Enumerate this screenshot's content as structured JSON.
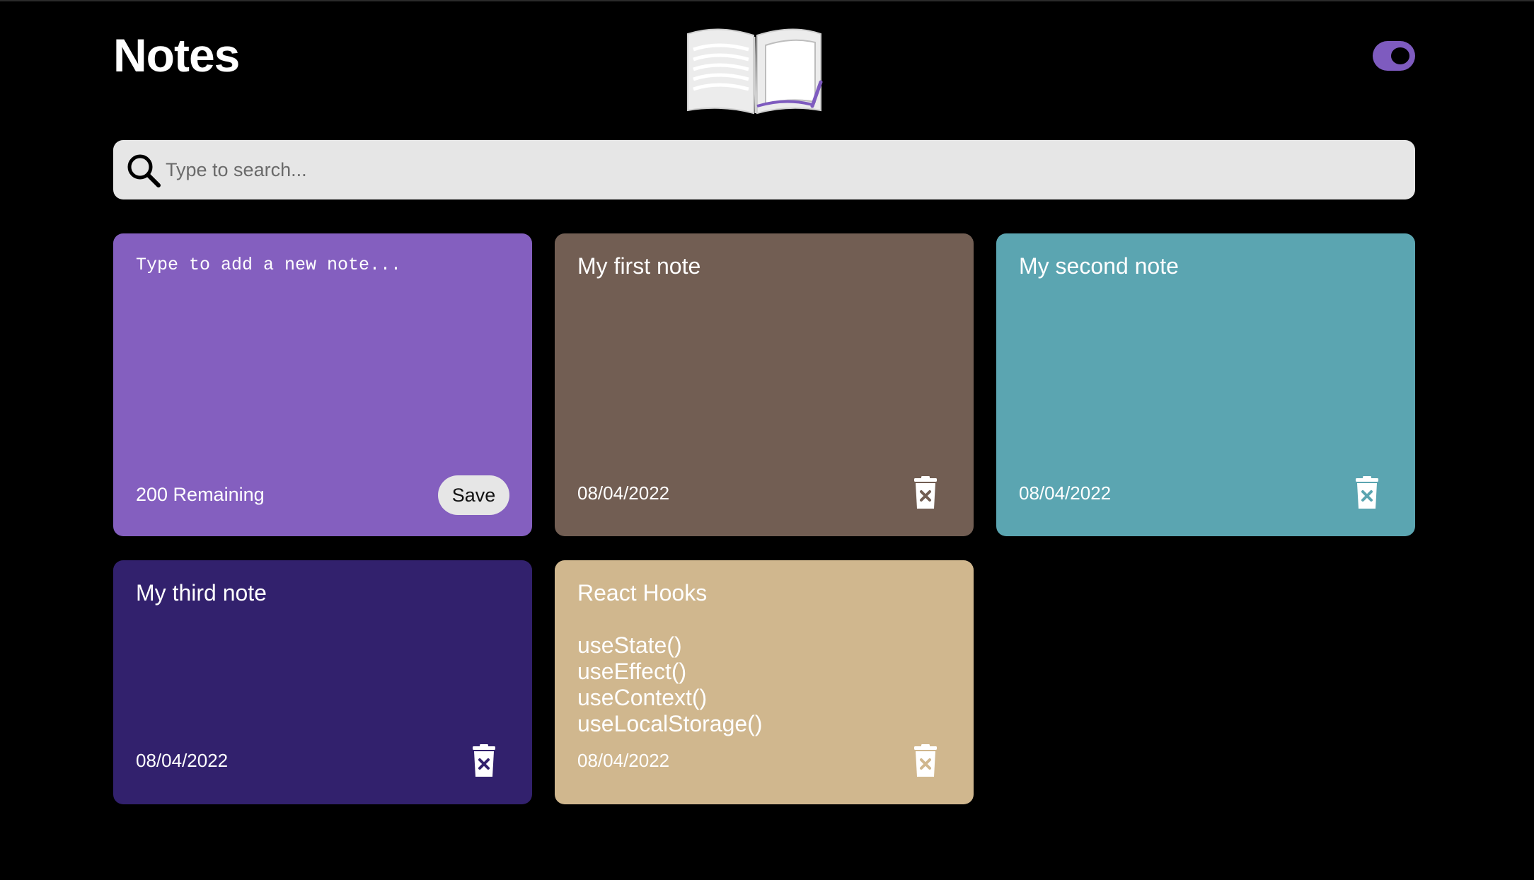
{
  "header": {
    "title": "Notes",
    "logo_icon": "open-book-icon",
    "theme_toggle": {
      "state": "on",
      "color": "#7e5bbf"
    }
  },
  "search": {
    "placeholder": "Type to search...",
    "icon": "search-icon"
  },
  "new_note": {
    "placeholder": "Type to add a new note...",
    "remaining_label": "200 Remaining",
    "save_label": "Save",
    "color": "#845fbf"
  },
  "notes": [
    {
      "text": "My first note",
      "date": "08/04/2022",
      "color": "#725e53"
    },
    {
      "text": "My second note",
      "date": "08/04/2022",
      "color": "#5ba5b1"
    },
    {
      "text": "My third note",
      "date": "08/04/2022",
      "color": "#32216d"
    },
    {
      "text": "React Hooks\n\nuseState()\nuseEffect()\nuseContext()\nuseLocalStorage()",
      "date": "08/04/2022",
      "color": "#d0b78e"
    }
  ],
  "delete_icon": "trash-delete-icon"
}
